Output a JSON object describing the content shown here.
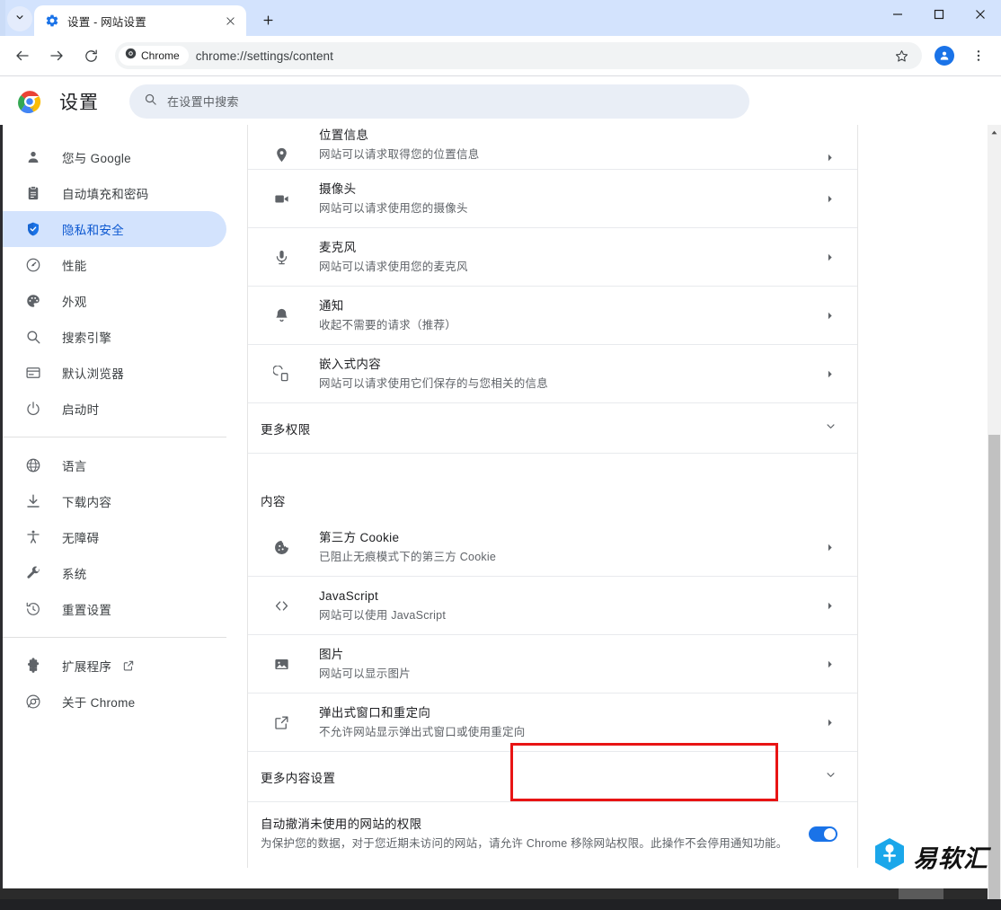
{
  "window": {
    "minimize_label": "—",
    "maximize_label": "□",
    "close_label": "✕"
  },
  "tabstrip": {
    "tab_search_icon": "chevron-down-icon",
    "tab": {
      "favicon": "settings-gear-icon",
      "title": "设置 - 网站设置",
      "close_icon": "close-icon"
    },
    "new_tab_label": "+"
  },
  "toolbar": {
    "back_icon": "back-arrow-icon",
    "forward_icon": "forward-arrow-icon",
    "reload_icon": "reload-icon",
    "chrome_chip_label": "Chrome",
    "url": "chrome://settings/content",
    "bookmark_icon": "star-icon",
    "profile_icon": "person-avatar-icon",
    "menu_icon": "three-dots-menu-icon"
  },
  "settings_header": {
    "title": "设置",
    "logo": "chrome-logo-icon",
    "search_placeholder": "在设置中搜索",
    "search_value": "",
    "search_icon": "search-icon"
  },
  "sidebar": {
    "groups": [
      {
        "items": [
          {
            "icon": "person-icon",
            "label": "您与 Google",
            "selected": false
          },
          {
            "icon": "clipboard-icon",
            "label": "自动填充和密码",
            "selected": false
          },
          {
            "icon": "shield-icon",
            "label": "隐私和安全",
            "selected": true
          },
          {
            "icon": "speedometer-icon",
            "label": "性能",
            "selected": false
          },
          {
            "icon": "palette-icon",
            "label": "外观",
            "selected": false
          },
          {
            "icon": "search-icon",
            "label": "搜索引擎",
            "selected": false
          },
          {
            "icon": "browser-window-icon",
            "label": "默认浏览器",
            "selected": false
          },
          {
            "icon": "power-icon",
            "label": "启动时",
            "selected": false
          }
        ]
      },
      {
        "items": [
          {
            "icon": "globe-icon",
            "label": "语言",
            "selected": false
          },
          {
            "icon": "download-icon",
            "label": "下载内容",
            "selected": false
          },
          {
            "icon": "accessibility-icon",
            "label": "无障碍",
            "selected": false
          },
          {
            "icon": "wrench-icon",
            "label": "系统",
            "selected": false
          },
          {
            "icon": "restore-clock-icon",
            "label": "重置设置",
            "selected": false
          }
        ]
      },
      {
        "items": [
          {
            "icon": "puzzle-icon",
            "label": "扩展程序",
            "selected": false,
            "external": true,
            "external_icon": "open-in-new-icon"
          },
          {
            "icon": "chrome-circle-icon",
            "label": "关于 Chrome",
            "selected": false
          }
        ]
      }
    ]
  },
  "content": {
    "permission_rows": [
      {
        "icon": "location-pin-icon",
        "title": "位置信息",
        "sub": "网站可以请求取得您的位置信息",
        "arrow": "chevron-right-icon"
      },
      {
        "icon": "camera-icon",
        "title": "摄像头",
        "sub": "网站可以请求使用您的摄像头",
        "arrow": "chevron-right-icon"
      },
      {
        "icon": "microphone-icon",
        "title": "麦克风",
        "sub": "网站可以请求使用您的麦克风",
        "arrow": "chevron-right-icon"
      },
      {
        "icon": "bell-icon",
        "title": "通知",
        "sub": "收起不需要的请求（推荐）",
        "arrow": "chevron-right-icon"
      },
      {
        "icon": "embedded-content-icon",
        "title": "嵌入式内容",
        "sub": "网站可以请求使用它们保存的与您相关的信息",
        "arrow": "chevron-right-icon"
      }
    ],
    "more_permissions": {
      "label": "更多权限",
      "arrow": "chevron-down-icon"
    },
    "content_section_label": "内容",
    "content_rows": [
      {
        "icon": "cookie-icon",
        "title": "第三方 Cookie",
        "sub": "已阻止无痕模式下的第三方 Cookie",
        "arrow": "chevron-right-icon",
        "highlighted": false
      },
      {
        "icon": "code-brackets-icon",
        "title": "JavaScript",
        "sub": "网站可以使用 JavaScript",
        "arrow": "chevron-right-icon",
        "highlighted": false
      },
      {
        "icon": "image-icon",
        "title": "图片",
        "sub": "网站可以显示图片",
        "arrow": "chevron-right-icon",
        "highlighted": true
      },
      {
        "icon": "open-in-new-icon",
        "title": "弹出式窗口和重定向",
        "sub": "不允许网站显示弹出式窗口或使用重定向",
        "arrow": "chevron-right-icon",
        "highlighted": false
      }
    ],
    "more_content_settings": {
      "label": "更多内容设置",
      "arrow": "chevron-down-icon"
    },
    "auto_revoke": {
      "title": "自动撤消未使用的网站的权限",
      "sub": "为保护您的数据，对于您近期未访问的网站，请允许 Chrome 移除网站权限。此操作不会停用通知功能。",
      "toggle_on": true
    }
  },
  "watermark": {
    "text": "易软汇",
    "logo": "yiruanhui-hexagon-logo"
  },
  "colors": {
    "accent_blue": "#1a73e8",
    "selected_nav_bg": "#d3e3fd",
    "selected_nav_text": "#0b57d0",
    "tabstrip_bg": "#d3e3fd",
    "annotation_red": "#e81414",
    "watermark_blue": "#1ba7ea",
    "toolbar_text": "#3c4043",
    "sub_text": "#5f6368"
  }
}
